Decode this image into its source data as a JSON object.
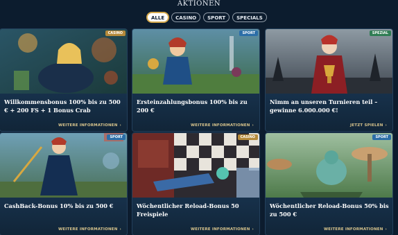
{
  "header": {
    "title": "AKTIONEN"
  },
  "tabs": [
    {
      "label": "ALLE",
      "active": true
    },
    {
      "label": "CASINO",
      "active": false
    },
    {
      "label": "SPORT",
      "active": false
    },
    {
      "label": "SPECIALS",
      "active": false
    }
  ],
  "cards": [
    {
      "badge": "CASINO",
      "title": "Willkommensbonus 100% bis zu 500 € + 200 FS + 1 Bonus Crab",
      "link": "WEITERE INFORMATIONEN"
    },
    {
      "badge": "SPORT",
      "title": "Ersteinzahlungsbonus 100% bis zu 200 €",
      "link": "WEITERE INFORMATIONEN"
    },
    {
      "badge": "SPEZIAL",
      "title": "Nimm an unseren Turnieren teil – gewinne 6.000.000 €!",
      "link": "JETZT SPIELEN"
    },
    {
      "badge": "SPORT",
      "title": "CashBack-Bonus 10% bis zu 500 €",
      "link": "WEITERE INFORMATIONEN"
    },
    {
      "badge": "CASINO",
      "title": "Wöchentlicher Reload-Bonus 50 Freispiele",
      "link": "WEITERE INFORMATIONEN"
    },
    {
      "badge": "SPORT",
      "title": "Wöchentlicher Reload-Bonus 50% bis zu 500 €",
      "link": "WEITERE INFORMATIONEN"
    }
  ],
  "icons": {
    "link_arrow": "chevron-right-icon"
  },
  "colors": {
    "background": "#0c1c2e",
    "card": "#14293f",
    "accent_gold": "#d4a84b",
    "casino_badge": "#b58a3a",
    "sport_badge": "#2c6ea8",
    "spezial_badge": "#2f7d53"
  }
}
